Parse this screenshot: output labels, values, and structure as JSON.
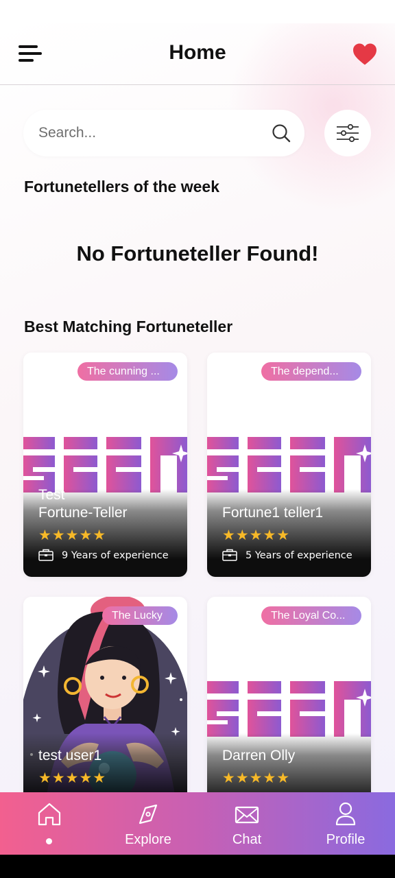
{
  "header": {
    "title": "Home"
  },
  "search": {
    "placeholder": "Search..."
  },
  "sections": {
    "week_title": "Fortunetellers of the week",
    "week_empty": "No Fortuneteller Found!",
    "best_title": "Best Matching Fortuneteller"
  },
  "cards": [
    {
      "badge": "The cunning ...",
      "name_line1": "Test",
      "name_line2": "Fortune-Teller",
      "stars": "★★★★★",
      "rating": 5,
      "experience": "9 Years of experience",
      "art": "seen-logo-icon"
    },
    {
      "badge": "The depend...",
      "name_line1": "",
      "name_line2": "Fortune1 teller1",
      "stars": "★★★★★",
      "rating": 5,
      "experience": "5 Years of experience",
      "art": "seen-logo-icon"
    },
    {
      "badge": "The Lucky",
      "name_line1": "",
      "name_line2": "test user1",
      "stars": "★★★★★",
      "rating": 5,
      "art": "fortuneteller-woman-avatar"
    },
    {
      "badge": "The Loyal Co...",
      "name_line1": "",
      "name_line2": "Darren Olly",
      "stars": "★★★★★",
      "rating": 5,
      "art": "seen-logo-icon"
    }
  ],
  "nav": {
    "items": [
      {
        "label": "",
        "icon": "home-icon",
        "active": true
      },
      {
        "label": "Explore",
        "icon": "compass-icon"
      },
      {
        "label": "Chat",
        "icon": "mail-icon"
      },
      {
        "label": "Profile",
        "icon": "user-icon"
      }
    ]
  },
  "colors": {
    "accent_pink": "#f2608f",
    "accent_purple": "#8a6adf",
    "heart": "#e53945",
    "star": "#f7b928"
  }
}
